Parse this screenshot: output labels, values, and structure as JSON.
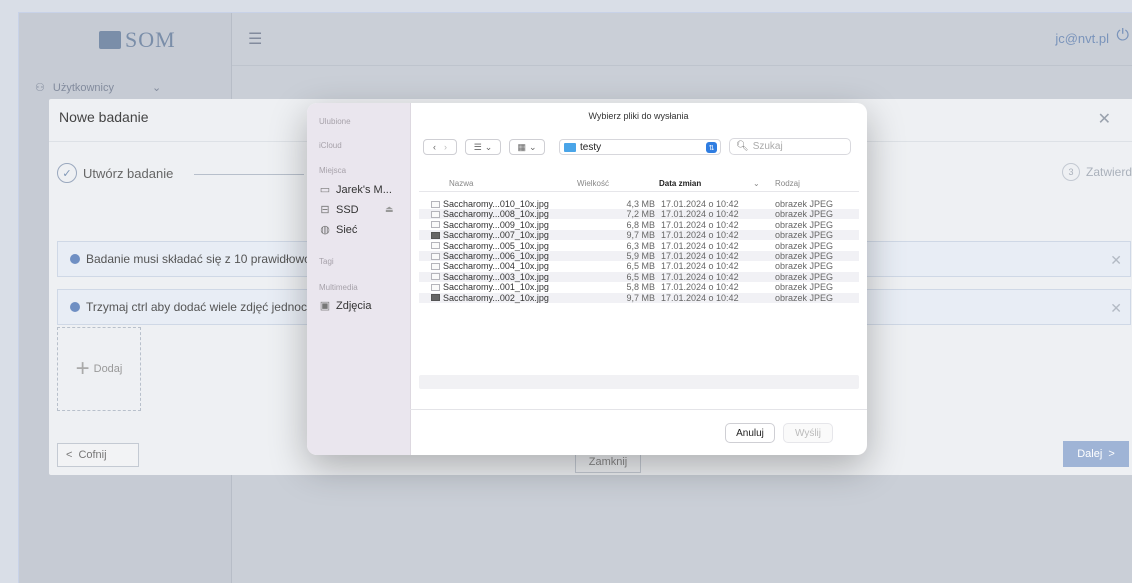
{
  "app": {
    "logo_text": "SOM",
    "sidebar_item": "Użytkownicy",
    "user_email": "jc@nvt.pl"
  },
  "modal": {
    "title": "Nowe badanie",
    "step1_label": "Utwórz badanie",
    "step3_number": "3",
    "step3_label": "Zatwierdź",
    "info1": "Badanie musi składać się z 10 prawidłowo",
    "info2": "Trzymaj ctrl aby dodać wiele zdjęć jednocz",
    "add_label": "Dodaj",
    "back_label": "Cofnij",
    "next_label": "Dalej",
    "close_label": "Zamknij"
  },
  "dialog": {
    "title": "Wybierz pliki do wysłania",
    "folder": "testy",
    "search_placeholder": "Szukaj",
    "sidebar": {
      "favorites_head": "Ulubione",
      "icloud_head": "iCloud",
      "places_head": "Miejsca",
      "places": [
        "Jarek's M...",
        "SSD",
        "Sieć"
      ],
      "tags_head": "Tagi",
      "media_head": "Multimedia",
      "media": [
        "Zdjęcia"
      ]
    },
    "columns": {
      "name": "Nazwa",
      "size": "Wielkość",
      "date": "Data zmian",
      "kind": "Rodzaj"
    },
    "files": [
      {
        "name": "Saccharomy...010_10x.jpg",
        "size": "4,3 MB",
        "date": "17.01.2024 o 10:42",
        "kind": "obrazek JPEG"
      },
      {
        "name": "Saccharomy...008_10x.jpg",
        "size": "7,2 MB",
        "date": "17.01.2024 o 10:42",
        "kind": "obrazek JPEG"
      },
      {
        "name": "Saccharomy...009_10x.jpg",
        "size": "6,8 MB",
        "date": "17.01.2024 o 10:42",
        "kind": "obrazek JPEG"
      },
      {
        "name": "Saccharomy...007_10x.jpg",
        "size": "9,7 MB",
        "date": "17.01.2024 o 10:42",
        "kind": "obrazek JPEG"
      },
      {
        "name": "Saccharomy...005_10x.jpg",
        "size": "6,3 MB",
        "date": "17.01.2024 o 10:42",
        "kind": "obrazek JPEG"
      },
      {
        "name": "Saccharomy...006_10x.jpg",
        "size": "5,9 MB",
        "date": "17.01.2024 o 10:42",
        "kind": "obrazek JPEG"
      },
      {
        "name": "Saccharomy...004_10x.jpg",
        "size": "6,5 MB",
        "date": "17.01.2024 o 10:42",
        "kind": "obrazek JPEG"
      },
      {
        "name": "Saccharomy...003_10x.jpg",
        "size": "6,5 MB",
        "date": "17.01.2024 o 10:42",
        "kind": "obrazek JPEG"
      },
      {
        "name": "Saccharomy...001_10x.jpg",
        "size": "5,8 MB",
        "date": "17.01.2024 o 10:42",
        "kind": "obrazek JPEG"
      },
      {
        "name": "Saccharomy...002_10x.jpg",
        "size": "9,7 MB",
        "date": "17.01.2024 o 10:42",
        "kind": "obrazek JPEG"
      }
    ],
    "cancel_label": "Anuluj",
    "send_label": "Wyślij"
  }
}
